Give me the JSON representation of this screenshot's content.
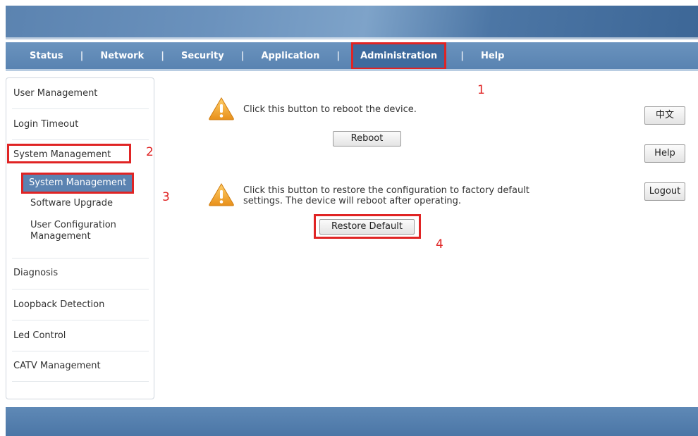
{
  "nav": {
    "items": [
      "Status",
      "Network",
      "Security",
      "Application",
      "Administration",
      "Help"
    ],
    "active": "Administration",
    "separator": "|"
  },
  "sidebar": {
    "user_management": "User Management",
    "login_timeout": "Login Timeout",
    "system_management": "System Management",
    "sub_system_management": "System Management",
    "sub_software_upgrade": "Software Upgrade",
    "sub_user_config_line1": "User Configuration",
    "sub_user_config_line2": "Management",
    "diagnosis": "Diagnosis",
    "loopback_detection": "Loopback Detection",
    "led_control": "Led Control",
    "catv_management": "CATV Management"
  },
  "main": {
    "reboot_message": "Click this button to reboot the device.",
    "reboot_button": "Reboot",
    "restore_message_line1": "Click this button to restore the configuration to factory default",
    "restore_message_line2": "settings. The device will reboot after operating.",
    "restore_button": "Restore Default"
  },
  "right_buttons": {
    "language": "中文",
    "help": "Help",
    "logout": "Logout"
  },
  "annotations": [
    "1",
    "2",
    "3",
    "4"
  ],
  "colors": {
    "nav_bar": "#5983b1",
    "highlight_red": "#e02424",
    "warning_orange": "#f0a030"
  }
}
